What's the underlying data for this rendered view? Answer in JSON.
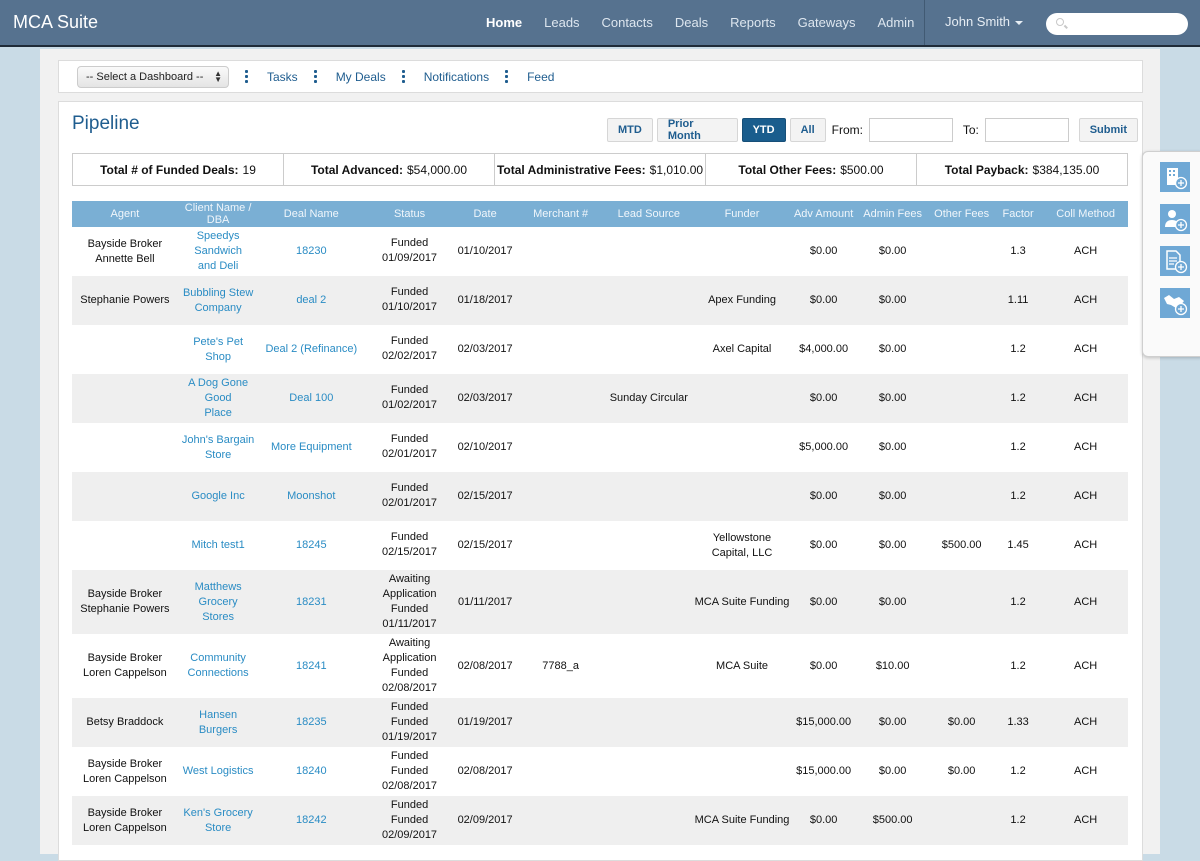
{
  "app": {
    "title": "MCA Suite"
  },
  "nav": {
    "items": [
      {
        "label": "Home",
        "active": true
      },
      {
        "label": "Leads"
      },
      {
        "label": "Contacts"
      },
      {
        "label": "Deals"
      },
      {
        "label": "Reports"
      },
      {
        "label": "Gateways"
      },
      {
        "label": "Admin"
      }
    ],
    "user": "John Smith",
    "search_placeholder": ""
  },
  "subbar": {
    "dashboard_select": "-- Select a Dashboard --",
    "links": [
      "Tasks",
      "My Deals",
      "Notifications",
      "Feed"
    ]
  },
  "pipeline": {
    "title": "Pipeline",
    "filters": {
      "buttons": [
        "MTD",
        "Prior Month",
        "YTD",
        "All"
      ],
      "active": "YTD",
      "from_label": "From:",
      "to_label": "To:",
      "from_value": "",
      "to_value": "",
      "submit": "Submit"
    },
    "stats": [
      {
        "label": "Total # of Funded Deals:",
        "value": "19"
      },
      {
        "label": "Total Advanced:",
        "value": "$54,000.00"
      },
      {
        "label": "Total Administrative Fees:",
        "value": "$1,010.00"
      },
      {
        "label": "Total Other Fees:",
        "value": "$500.00"
      },
      {
        "label": "Total Payback:",
        "value": "$384,135.00"
      }
    ],
    "columns": [
      "Agent",
      "Client Name / DBA",
      "Deal Name",
      "Status",
      "Date",
      "Merchant #",
      "Lead Source",
      "Funder",
      "Adv Amount",
      "Admin Fees",
      "Other Fees",
      "Factor",
      "Coll Method"
    ],
    "rows": [
      {
        "agent": [
          "Bayside Broker",
          "Annette Bell"
        ],
        "client": [
          "Speedys Sandwich",
          "and Deli"
        ],
        "deal": "18230",
        "status": [
          "Funded 01/09/2017"
        ],
        "date": "01/10/2017",
        "merchant": "",
        "lead": "",
        "funder": [
          ""
        ],
        "adv": "$0.00",
        "admin": "$0.00",
        "other": "",
        "factor": "1.3",
        "coll": "ACH"
      },
      {
        "agent": [
          "Stephanie Powers"
        ],
        "client": [
          "Bubbling Stew",
          "Company"
        ],
        "deal": "deal 2",
        "status": [
          "Funded 01/10/2017"
        ],
        "date": "01/18/2017",
        "merchant": "",
        "lead": "",
        "funder": [
          "Apex Funding"
        ],
        "adv": "$0.00",
        "admin": "$0.00",
        "other": "",
        "factor": "1.11",
        "coll": "ACH"
      },
      {
        "agent": [
          ""
        ],
        "client": [
          "Pete's Pet Shop"
        ],
        "deal": "Deal 2 (Refinance)",
        "status": [
          "Funded 02/02/2017"
        ],
        "date": "02/03/2017",
        "merchant": "",
        "lead": "",
        "funder": [
          "Axel Capital"
        ],
        "adv": "$4,000.00",
        "admin": "$0.00",
        "other": "",
        "factor": "1.2",
        "coll": "ACH"
      },
      {
        "agent": [
          ""
        ],
        "client": [
          "A Dog Gone Good",
          "Place"
        ],
        "deal": "Deal 100",
        "status": [
          "Funded 01/02/2017"
        ],
        "date": "02/03/2017",
        "merchant": "",
        "lead": "Sunday Circular",
        "funder": [
          ""
        ],
        "adv": "$0.00",
        "admin": "$0.00",
        "other": "",
        "factor": "1.2",
        "coll": "ACH"
      },
      {
        "agent": [
          ""
        ],
        "client": [
          "John's Bargain",
          "Store"
        ],
        "deal": "More Equipment",
        "status": [
          "Funded 02/01/2017"
        ],
        "date": "02/10/2017",
        "merchant": "",
        "lead": "",
        "funder": [
          ""
        ],
        "adv": "$5,000.00",
        "admin": "$0.00",
        "other": "",
        "factor": "1.2",
        "coll": "ACH"
      },
      {
        "agent": [
          ""
        ],
        "client": [
          "Google Inc"
        ],
        "deal": "Moonshot",
        "status": [
          "Funded 02/01/2017"
        ],
        "date": "02/15/2017",
        "merchant": "",
        "lead": "",
        "funder": [
          ""
        ],
        "adv": "$0.00",
        "admin": "$0.00",
        "other": "",
        "factor": "1.2",
        "coll": "ACH"
      },
      {
        "agent": [
          ""
        ],
        "client": [
          "Mitch test1"
        ],
        "deal": "18245",
        "status": [
          "Funded 02/15/2017"
        ],
        "date": "02/15/2017",
        "merchant": "",
        "lead": "",
        "funder": [
          "Yellowstone",
          "Capital, LLC"
        ],
        "adv": "$0.00",
        "admin": "$0.00",
        "other": "$500.00",
        "factor": "1.45",
        "coll": "ACH"
      },
      {
        "agent": [
          "Bayside Broker",
          "Stephanie Powers"
        ],
        "client": [
          "Matthews Grocery",
          "Stores"
        ],
        "deal": "18231",
        "status": [
          "Awaiting",
          "Application",
          "Funded 01/11/2017"
        ],
        "date": "01/11/2017",
        "merchant": "",
        "lead": "",
        "funder": [
          "MCA Suite Funding"
        ],
        "adv": "$0.00",
        "admin": "$0.00",
        "other": "",
        "factor": "1.2",
        "coll": "ACH"
      },
      {
        "agent": [
          "Bayside Broker",
          "Loren Cappelson"
        ],
        "client": [
          "Community",
          "Connections"
        ],
        "deal": "18241",
        "status": [
          "Awaiting",
          "Application",
          "Funded 02/08/2017"
        ],
        "date": "02/08/2017",
        "merchant": "7788_a",
        "lead": "",
        "funder": [
          "MCA Suite"
        ],
        "adv": "$0.00",
        "admin": "$10.00",
        "other": "",
        "factor": "1.2",
        "coll": "ACH"
      },
      {
        "agent": [
          "Betsy Braddock"
        ],
        "client": [
          "Hansen Burgers"
        ],
        "deal": "18235",
        "status": [
          "Funded",
          "Funded 01/19/2017"
        ],
        "date": "01/19/2017",
        "merchant": "",
        "lead": "",
        "funder": [
          ""
        ],
        "adv": "$15,000.00",
        "admin": "$0.00",
        "other": "$0.00",
        "factor": "1.33",
        "coll": "ACH"
      },
      {
        "agent": [
          "Bayside Broker",
          "Loren Cappelson"
        ],
        "client": [
          "West Logistics"
        ],
        "deal": "18240",
        "status": [
          "Funded",
          "Funded 02/08/2017"
        ],
        "date": "02/08/2017",
        "merchant": "",
        "lead": "",
        "funder": [
          ""
        ],
        "adv": "$15,000.00",
        "admin": "$0.00",
        "other": "$0.00",
        "factor": "1.2",
        "coll": "ACH"
      },
      {
        "agent": [
          "Bayside Broker",
          "Loren Cappelson"
        ],
        "client": [
          "Ken's Grocery",
          "Store"
        ],
        "deal": "18242",
        "status": [
          "Funded",
          "Funded 02/09/2017"
        ],
        "date": "02/09/2017",
        "merchant": "",
        "lead": "",
        "funder": [
          "MCA Suite Funding"
        ],
        "adv": "$0.00",
        "admin": "$500.00",
        "other": "",
        "factor": "1.2",
        "coll": "ACH"
      }
    ]
  },
  "quick_add": {
    "icons": [
      "add-company-icon",
      "add-contact-icon",
      "add-document-icon",
      "add-deal-icon"
    ]
  }
}
